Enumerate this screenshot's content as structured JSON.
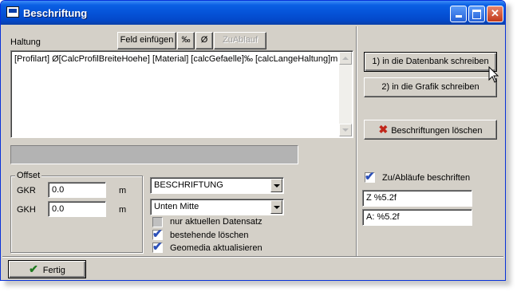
{
  "window": {
    "title": "Beschriftung"
  },
  "haltung": {
    "label": "Haltung",
    "text": "[Profilart] Ø[CalcProfilBreiteHoehe] [Material] [calcGefaelle]‰ [calcLangeHaltung]m"
  },
  "toolbar": {
    "feld_einfuegen": "Feld einfügen",
    "permille": "‰",
    "diameter": "Ø",
    "zuablauf": "ZuAblauf"
  },
  "offset": {
    "legend": "Offset",
    "gkr_label": "GKR",
    "gkr_value": "0.0",
    "gkr_unit": "m",
    "gkh_label": "GKH",
    "gkh_value": "0.0",
    "gkh_unit": "m"
  },
  "dropdowns": {
    "beschriftung": "BESCHRIFTUNG",
    "position": "Unten Mitte"
  },
  "options": {
    "nur_aktuellen": {
      "label": "nur aktuellen Datensatz",
      "checked": false
    },
    "bestehende_loeschen": {
      "label": "bestehende löschen",
      "checked": true
    },
    "geomedia": {
      "label": "Geomedia aktualisieren",
      "checked": true
    }
  },
  "right": {
    "btn_datenbank": "1) in die Datenbank schreiben",
    "btn_grafik": "2) in die Grafik schreiben",
    "btn_loeschen": "Beschriftungen löschen",
    "zu_ablaeufe_label": "Zu/Abläufe beschriften",
    "zu_ablaeufe_checked": true,
    "format_z": "Z %5.2f",
    "format_a": "A: %5.2f"
  },
  "footer": {
    "fertig": "Fertig"
  },
  "colors": {
    "titlebar": "#0553d8",
    "face": "#d4d0c8",
    "delete_x": "#c0261a",
    "check": "#2b4fb8"
  }
}
